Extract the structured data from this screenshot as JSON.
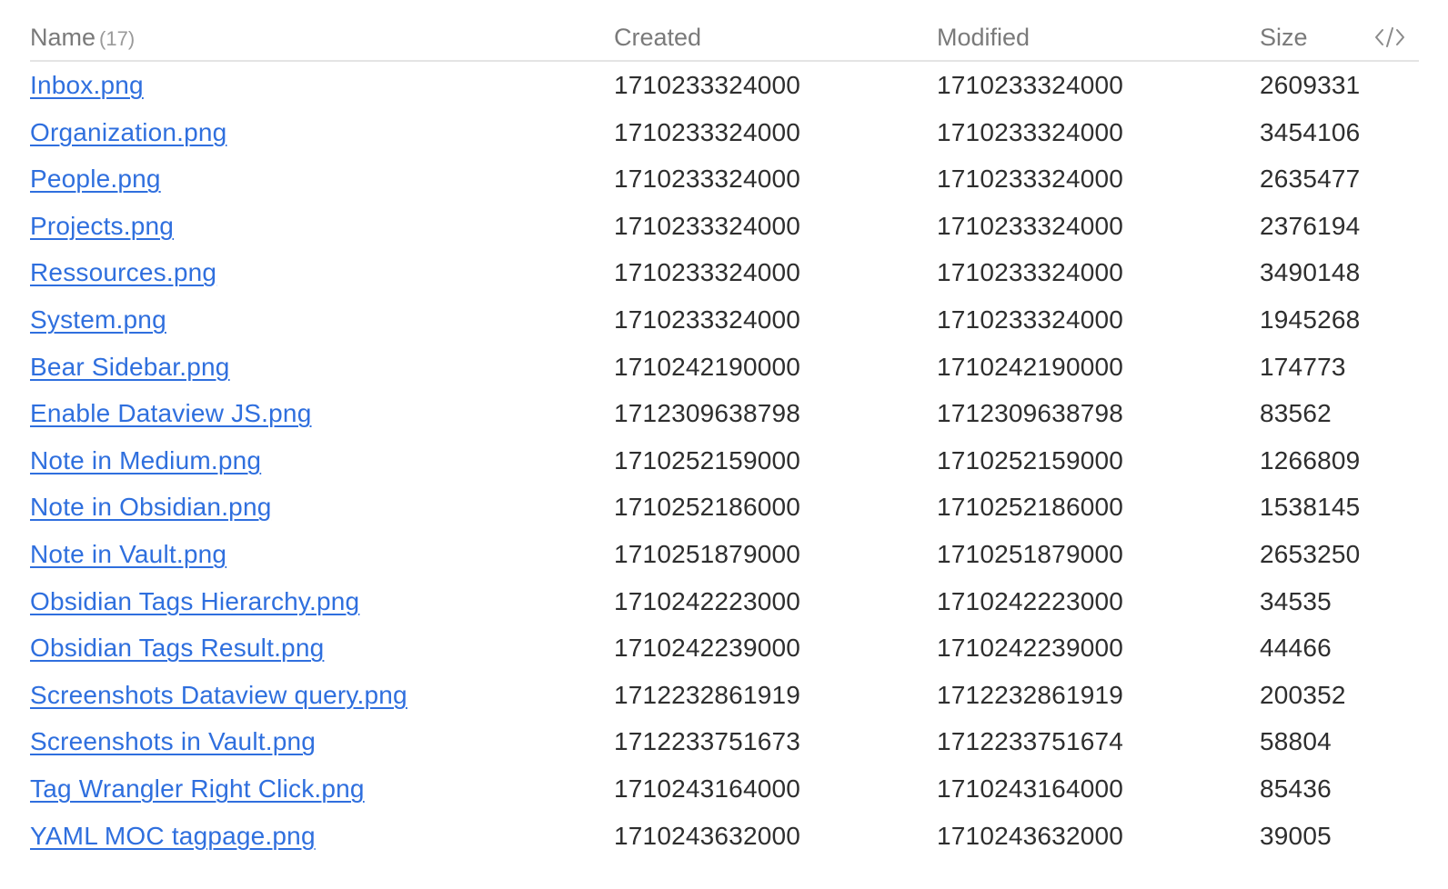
{
  "table": {
    "headers": {
      "name": "Name",
      "count": "(17)",
      "created": "Created",
      "modified": "Modified",
      "size": "Size"
    },
    "toggle_icon": "code-icon",
    "colors": {
      "link": "#2f6fde",
      "header_text": "#7a7a7a",
      "body_text": "#2e2e2e",
      "divider": "#e4e4e4"
    },
    "rows": [
      {
        "name": "Inbox.png",
        "created": "1710233324000",
        "modified": "1710233324000",
        "size": "2609331"
      },
      {
        "name": "Organization.png",
        "created": "1710233324000",
        "modified": "1710233324000",
        "size": "3454106"
      },
      {
        "name": "People.png",
        "created": "1710233324000",
        "modified": "1710233324000",
        "size": "2635477"
      },
      {
        "name": "Projects.png",
        "created": "1710233324000",
        "modified": "1710233324000",
        "size": "2376194"
      },
      {
        "name": "Ressources.png",
        "created": "1710233324000",
        "modified": "1710233324000",
        "size": "3490148"
      },
      {
        "name": "System.png",
        "created": "1710233324000",
        "modified": "1710233324000",
        "size": "1945268"
      },
      {
        "name": "Bear Sidebar.png",
        "created": "1710242190000",
        "modified": "1710242190000",
        "size": "174773"
      },
      {
        "name": "Enable Dataview JS.png",
        "created": "1712309638798",
        "modified": "1712309638798",
        "size": "83562"
      },
      {
        "name": "Note in Medium.png",
        "created": "1710252159000",
        "modified": "1710252159000",
        "size": "1266809"
      },
      {
        "name": "Note in Obsidian.png",
        "created": "1710252186000",
        "modified": "1710252186000",
        "size": "1538145"
      },
      {
        "name": "Note in Vault.png",
        "created": "1710251879000",
        "modified": "1710251879000",
        "size": "2653250"
      },
      {
        "name": "Obsidian Tags Hierarchy.png",
        "created": "1710242223000",
        "modified": "1710242223000",
        "size": "34535"
      },
      {
        "name": "Obsidian Tags Result.png",
        "created": "1710242239000",
        "modified": "1710242239000",
        "size": "44466"
      },
      {
        "name": "Screenshots Dataview query.png",
        "created": "1712232861919",
        "modified": "1712232861919",
        "size": "200352"
      },
      {
        "name": "Screenshots in Vault.png",
        "created": "1712233751673",
        "modified": "1712233751674",
        "size": "58804"
      },
      {
        "name": "Tag Wrangler Right Click.png",
        "created": "1710243164000",
        "modified": "1710243164000",
        "size": "85436"
      },
      {
        "name": "YAML MOC tagpage.png",
        "created": "1710243632000",
        "modified": "1710243632000",
        "size": "39005"
      }
    ]
  }
}
